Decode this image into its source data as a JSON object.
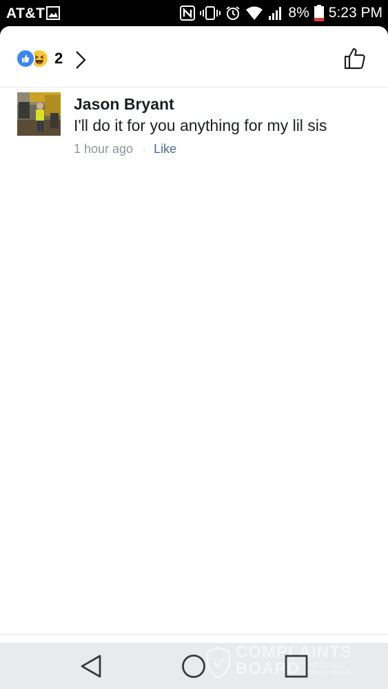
{
  "status_bar": {
    "carrier": "AT&T",
    "battery": "8%",
    "time": "5:23 PM",
    "icons": [
      "gallery-icon",
      "nfc-icon",
      "vibrate-icon",
      "alarm-icon",
      "wifi-icon",
      "signal-icon",
      "battery-icon"
    ]
  },
  "header": {
    "reactions": [
      "like",
      "haha"
    ],
    "reaction_count": "2",
    "colors": {
      "like": "#3b86f1",
      "haha": "#f7c737"
    }
  },
  "comment": {
    "author": "Jason Bryant",
    "text": "I'll do it for you anything for my lil sis",
    "time": "1 hour ago",
    "separator": "·",
    "like_label": "Like",
    "colors": {
      "like_link": "#4b67a1",
      "meta": "#90949c"
    }
  },
  "watermark": {
    "line1": "COMPLAINTS",
    "line2": "BOARD",
    "sub1": "RESOLVE",
    "sub2": "YOUR ISSUE"
  },
  "nav_bar": {
    "icons": [
      "back-icon",
      "home-icon",
      "recents-icon"
    ]
  }
}
